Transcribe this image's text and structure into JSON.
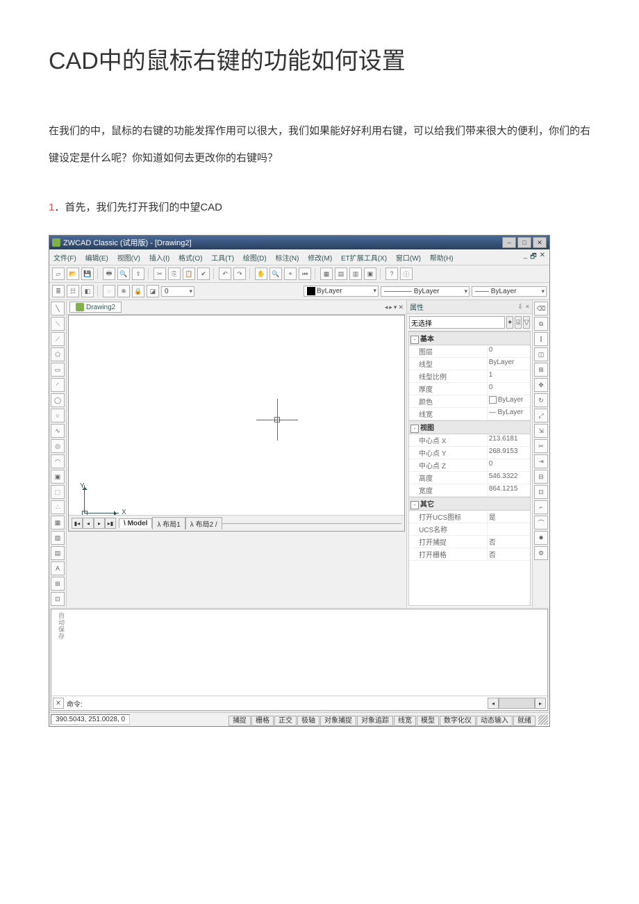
{
  "document": {
    "title": "CAD中的鼠标右键的功能如何设置",
    "intro": "在我们的中，鼠标的右键的功能发挥作用可以很大，我们如果能好好利用右键，可以给我们带来很大的便利，你们的右键设定是什么呢？你知道如何去更改你的右键吗？",
    "step1_num": "1",
    "step1_text": "．首先，我们先打开我们的中望CAD"
  },
  "titlebar": {
    "title": "ZWCAD Classic (试用版) - [Drawing2]",
    "min": "–",
    "max": "□",
    "close": "✕"
  },
  "menubar": {
    "items": [
      "文件(F)",
      "编辑(E)",
      "视图(V)",
      "插入(I)",
      "格式(O)",
      "工具(T)",
      "绘图(D)",
      "标注(N)",
      "修改(M)",
      "ET扩展工具(X)",
      "窗口(W)",
      "帮助(H)"
    ],
    "doc_min": "_",
    "doc_max": "🗗",
    "doc_close": "✕"
  },
  "layer_toolbar": {
    "color_label": "ByLayer",
    "bylayer1": "ByLayer",
    "bylayer2": "ByLayer"
  },
  "drawing_tab": "Drawing2",
  "nav": {
    "first": "◂",
    "prev": "▸",
    "pin": "▾",
    "close": "✕"
  },
  "ucs": {
    "x": "X",
    "y": "Y"
  },
  "model_tabs": {
    "first": "▮◂",
    "prev": "◂",
    "next": "▸",
    "last": "▸▮",
    "model": "Model",
    "layout1": "布局1",
    "layout2": "布局2"
  },
  "properties": {
    "title": "属性",
    "pin": "⇩",
    "close": "×",
    "no_selection": "无选择",
    "btn_add": "✦",
    "btn_pick": "⍃",
    "btn_filter": "▽",
    "group_basic": "基本",
    "rows_basic": [
      {
        "k": "图层",
        "v": "0"
      },
      {
        "k": "线型",
        "v": "ByLayer"
      },
      {
        "k": "线型比例",
        "v": "1"
      },
      {
        "k": "厚度",
        "v": "0"
      },
      {
        "k": "颜色",
        "v": "ByLayer",
        "swatch": "#fff"
      },
      {
        "k": "线宽",
        "v": "— ByLayer"
      }
    ],
    "group_view": "视图",
    "rows_view": [
      {
        "k": "中心点 X",
        "v": "213.6181"
      },
      {
        "k": "中心点 Y",
        "v": "268.9153"
      },
      {
        "k": "中心点 Z",
        "v": "0"
      },
      {
        "k": "高度",
        "v": "546.3322"
      },
      {
        "k": "宽度",
        "v": "864.1215"
      }
    ],
    "group_other": "其它",
    "rows_other": [
      {
        "k": "打开UCS图标",
        "v": "是"
      },
      {
        "k": "UCS名称",
        "v": ""
      },
      {
        "k": "打开捕捉",
        "v": "否"
      },
      {
        "k": "打开栅格",
        "v": "否"
      }
    ]
  },
  "command": {
    "hist": "自动保存",
    "close": "✕",
    "label": "命令:",
    "left": "◂",
    "right": "▸"
  },
  "status": {
    "coords": "390.5043, 251.0028, 0",
    "buttons": [
      "捕捉",
      "栅格",
      "正交",
      "极轴",
      "对象捕捉",
      "对象追踪",
      "线宽",
      "模型",
      "数字化仪",
      "动态输入",
      "就绪"
    ]
  }
}
